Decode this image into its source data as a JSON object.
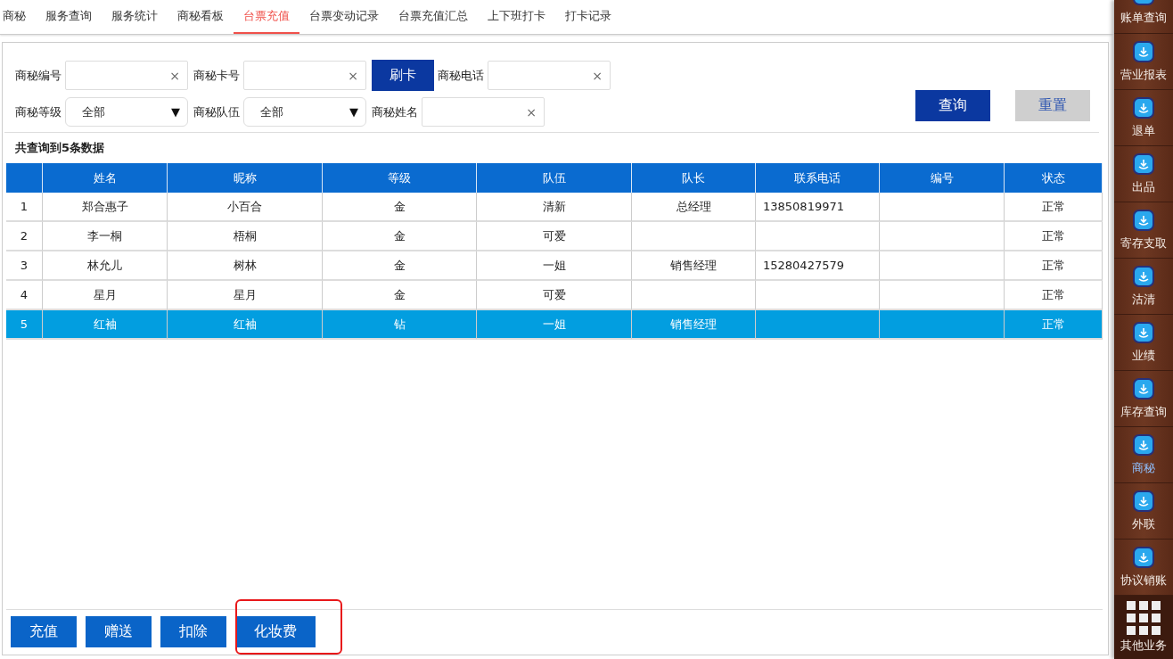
{
  "tabs": [
    {
      "label": "商秘",
      "selected": false
    },
    {
      "label": "服务查询",
      "selected": false
    },
    {
      "label": "服务统计",
      "selected": false
    },
    {
      "label": "商秘看板",
      "selected": false
    },
    {
      "label": "台票充值",
      "selected": true
    },
    {
      "label": "台票变动记录",
      "selected": false
    },
    {
      "label": "台票充值汇总",
      "selected": false
    },
    {
      "label": "上下班打卡",
      "selected": false
    },
    {
      "label": "打卡记录",
      "selected": false
    }
  ],
  "filters": [
    [
      {
        "kind": "field",
        "label": "商秘编号",
        "clear": "×"
      },
      {
        "kind": "field",
        "label": "商秘卡号",
        "clear": "×"
      },
      {
        "kind": "button",
        "label": "刷卡"
      },
      {
        "kind": "field",
        "label": "商秘电话",
        "clear": "×"
      }
    ],
    [
      {
        "kind": "select",
        "label": "商秘等级",
        "value": "全部",
        "caret": "▼"
      },
      {
        "kind": "select",
        "label": "商秘队伍",
        "value": "全部",
        "caret": "▼"
      },
      {
        "kind": "field",
        "label": "商秘姓名",
        "clear": "×"
      }
    ]
  ],
  "actions": [
    {
      "kind": "primary",
      "label": "查询"
    },
    {
      "kind": "secondary",
      "label": "重置"
    }
  ],
  "result_count": "共查询到5条数据",
  "table": {
    "columns": [
      "",
      "姓名",
      "昵称",
      "等级",
      "队伍",
      "队长",
      "联系电话",
      "编号",
      "状态"
    ],
    "rows": [
      {
        "selected": false,
        "cells": [
          "1",
          "郑合惠子",
          "小百合",
          "金",
          "清新",
          "总经理",
          "13850819971",
          "",
          "正常"
        ]
      },
      {
        "selected": false,
        "cells": [
          "2",
          "李一桐",
          "梧桐",
          "金",
          "可爱",
          "",
          "",
          "",
          "正常"
        ]
      },
      {
        "selected": false,
        "cells": [
          "3",
          "林允儿",
          "树林",
          "金",
          "一姐",
          "销售经理",
          "15280427579",
          "",
          "正常"
        ]
      },
      {
        "selected": false,
        "cells": [
          "4",
          "星月",
          "星月",
          "金",
          "可爱",
          "",
          "",
          "",
          "正常"
        ]
      },
      {
        "selected": true,
        "cells": [
          "5",
          "红袖",
          "红袖",
          "钻",
          "一姐",
          "销售经理",
          "",
          "",
          "正常"
        ]
      }
    ]
  },
  "bottom_buttons": [
    {
      "label": "充值",
      "highlighted": false
    },
    {
      "label": "赠送",
      "highlighted": false
    },
    {
      "label": "扣除",
      "highlighted": false
    },
    {
      "label": "化妆费",
      "highlighted": true
    }
  ],
  "sidebar": {
    "items": [
      {
        "label": "账单查询",
        "selected": false,
        "kind": "app"
      },
      {
        "label": "营业报表",
        "selected": false,
        "kind": "app"
      },
      {
        "label": "退单",
        "selected": false,
        "kind": "app"
      },
      {
        "label": "出品",
        "selected": false,
        "kind": "app"
      },
      {
        "label": "寄存支取",
        "selected": false,
        "kind": "app"
      },
      {
        "label": "沽清",
        "selected": false,
        "kind": "app"
      },
      {
        "label": "业绩",
        "selected": false,
        "kind": "app"
      },
      {
        "label": "库存查询",
        "selected": false,
        "kind": "app"
      },
      {
        "label": "商秘",
        "selected": true,
        "kind": "app"
      },
      {
        "label": "外联",
        "selected": false,
        "kind": "app"
      },
      {
        "label": "协议销账",
        "selected": false,
        "kind": "app"
      },
      {
        "label": "其他业务",
        "selected": false,
        "kind": "more"
      }
    ]
  }
}
